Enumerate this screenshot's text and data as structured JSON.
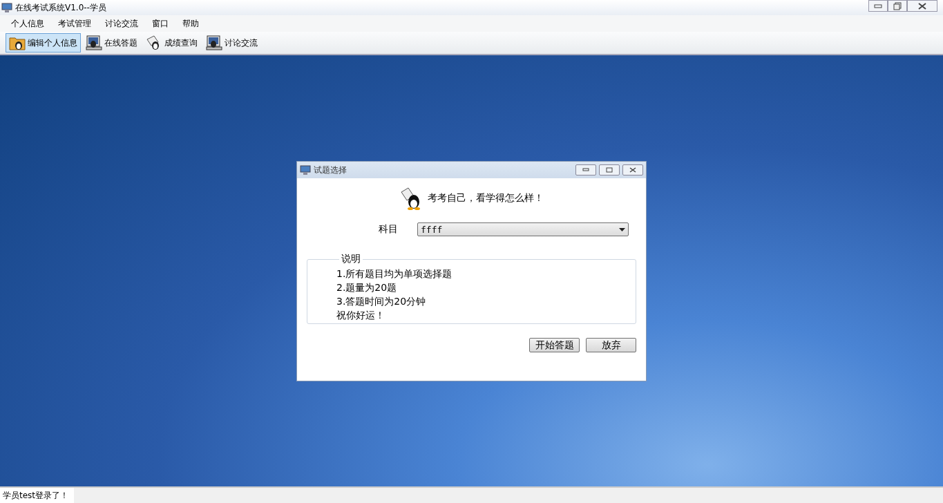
{
  "window": {
    "title": "在线考试系统V1.0--学员"
  },
  "menu": [
    "个人信息",
    "考试管理",
    "讨论交流",
    "窗口",
    "帮助"
  ],
  "toolbar": [
    {
      "label": "编辑个人信息",
      "selected": true,
      "kind": "folder"
    },
    {
      "label": "在线答题",
      "selected": false,
      "kind": "computer"
    },
    {
      "label": "成绩查询",
      "selected": false,
      "kind": "paper"
    },
    {
      "label": "讨论交流",
      "selected": false,
      "kind": "computer"
    }
  ],
  "dialog": {
    "title": "试题选择",
    "heading": "考考自己，看学得怎么样！",
    "subject_label": "科目",
    "subject_value": "ffff",
    "notes_title": "说明",
    "notes": [
      "1.所有题目均为单项选择题",
      "2.题量为20题",
      "3.答题时间为20分钟",
      "祝你好运！"
    ],
    "buttons": [
      "开始答题",
      "放弃"
    ]
  },
  "status_bar": "学员test登录了！"
}
